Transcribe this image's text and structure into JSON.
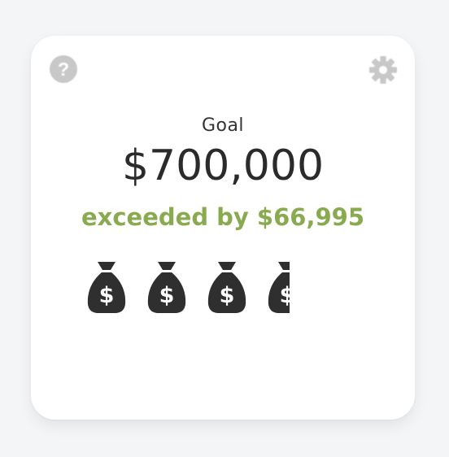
{
  "widget": {
    "goal_label": "Goal",
    "goal_amount": "$700,000",
    "status_text": "exceeded by $66,995",
    "status_color": "#8aaa4f",
    "icon_color": "#2f2f2f",
    "money_bag_glyph": "$",
    "money_bag_count_visible": 4,
    "help_icon_glyph": "?",
    "help_icon": "question-circle-icon",
    "settings_icon": "gear-icon"
  }
}
